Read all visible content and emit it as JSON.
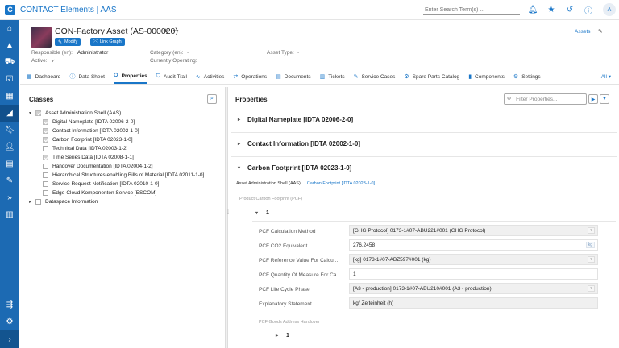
{
  "app": {
    "title": "CONTACT Elements | AAS",
    "logo_letter": "C"
  },
  "search": {
    "placeholder": "Enter Search Term(s) ..."
  },
  "user": {
    "initial": "A"
  },
  "object": {
    "title": "CON-Factory Asset (AS-000020)",
    "modify_label": "Modify",
    "link_graph_label": "Link Graph",
    "responsible_label": "Responsible (en):",
    "responsible_value": "Administrator",
    "active_label": "Active:",
    "active_value": "✓",
    "category_label": "Category (en):",
    "category_value": "-",
    "operating_label": "Currently Operating:",
    "asset_type_label": "Asset Type:",
    "asset_type_value": "-",
    "assets_link": "Assets"
  },
  "tabs": [
    {
      "label": "Dashboard",
      "icon": "dashboard-icon"
    },
    {
      "label": "Data Sheet",
      "icon": "info-icon"
    },
    {
      "label": "Properties",
      "icon": "properties-icon"
    },
    {
      "label": "Audit Trail",
      "icon": "shield-icon"
    },
    {
      "label": "Activities",
      "icon": "activity-icon"
    },
    {
      "label": "Operations",
      "icon": "operations-icon"
    },
    {
      "label": "Documents",
      "icon": "document-icon"
    },
    {
      "label": "Tickets",
      "icon": "ticket-icon"
    },
    {
      "label": "Service Cases",
      "icon": "wrench-icon"
    },
    {
      "label": "Spare Parts Catalog",
      "icon": "gear-icon"
    },
    {
      "label": "Components",
      "icon": "chart-icon"
    },
    {
      "label": "Settings",
      "icon": "settings-icon"
    }
  ],
  "tabs_all": "All",
  "classes": {
    "title": "Classes",
    "root": "Asset Administration Shell (AAS)",
    "items": [
      {
        "label": "Digital Nameplate [IDTA 02006-2-0]",
        "checked": true
      },
      {
        "label": "Contact Information [IDTA 02002-1-0]",
        "checked": true
      },
      {
        "label": "Carbon Footprint [IDTA 02023-1-0]",
        "checked": true
      },
      {
        "label": "Technical Data [IDTA 02003-1-2]",
        "checked": false
      },
      {
        "label": "Time Series Data [IDTA 02008-1-1]",
        "checked": true
      },
      {
        "label": "Handover Documentation [IDTA 02004-1-2]",
        "checked": false
      },
      {
        "label": "Hierarchical Structures enabling Bills of Material [IDTA 02011-1-0]",
        "checked": false
      },
      {
        "label": "Service Request Notification [IDTA 02010-1-0]",
        "checked": false
      },
      {
        "label": "Edge-Cloud Komponenten Service [ESCOM]",
        "checked": false
      }
    ],
    "root2": "Dataspace Information"
  },
  "properties": {
    "title": "Properties",
    "filter_placeholder": "Filter Properties...",
    "sections": [
      "Digital Nameplate [IDTA 02006-2-0]",
      "Contact Information [IDTA 02002-1-0]",
      "Carbon Footprint [IDTA 02023-1-0]"
    ],
    "crumb_root": "Asset Administration Shell (AAS)",
    "crumb_link": "Carbon Footprint [IDTA 02023-1-0]",
    "group_label": "Product Carbon Footprint (PCF)",
    "item_no": "1",
    "rows": [
      {
        "label": "PCF Calculation Method",
        "value": "[GHG Protocol] 0173-1#07-ABU221#001 (GHG Protocol)"
      },
      {
        "label": "PCF CO2 Equivalent",
        "value": "276.2458",
        "unit": "kg"
      },
      {
        "label": "PCF Reference Value For Calculation",
        "value": "[kg] 0173-1#07-ABZ597#001 (kg)"
      },
      {
        "label": "PCF Quantity Of Measure For Calculation",
        "value": "1"
      },
      {
        "label": "PCF Life Cycle Phase",
        "value": "[A3 - production] 0173-1#07-ABU210#001 (A3 - production)"
      },
      {
        "label": "Explanatory Statement",
        "value": "kg/ Zeiteinheit (h)"
      }
    ],
    "subgroup_label": "PCF Goods Address Handover",
    "sub_item_no": "1"
  },
  "colors": {
    "brand": "#1976c8",
    "rail": "#1c6ab3"
  }
}
